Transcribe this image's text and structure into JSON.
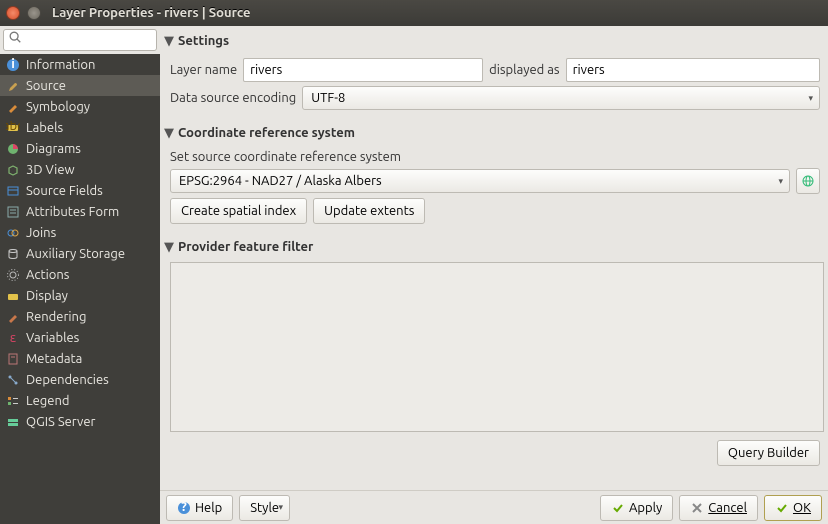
{
  "window": {
    "title": "Layer Properties - rivers | Source"
  },
  "sidebar": {
    "search_placeholder": "",
    "items": [
      {
        "label": "Information"
      },
      {
        "label": "Source"
      },
      {
        "label": "Symbology"
      },
      {
        "label": "Labels"
      },
      {
        "label": "Diagrams"
      },
      {
        "label": "3D View"
      },
      {
        "label": "Source Fields"
      },
      {
        "label": "Attributes Form"
      },
      {
        "label": "Joins"
      },
      {
        "label": "Auxiliary Storage"
      },
      {
        "label": "Actions"
      },
      {
        "label": "Display"
      },
      {
        "label": "Rendering"
      },
      {
        "label": "Variables"
      },
      {
        "label": "Metadata"
      },
      {
        "label": "Dependencies"
      },
      {
        "label": "Legend"
      },
      {
        "label": "QGIS Server"
      }
    ],
    "selected_index": 1
  },
  "sections": {
    "settings": {
      "title": "Settings",
      "layer_name_label": "Layer name",
      "layer_name_value": "rivers",
      "displayed_as_label": "displayed as",
      "displayed_as_value": "rivers",
      "encoding_label": "Data source encoding",
      "encoding_value": "UTF-8"
    },
    "crs": {
      "title": "Coordinate reference system",
      "set_label": "Set source coordinate reference system",
      "crs_value": "EPSG:2964 - NAD27 / Alaska Albers",
      "create_spatial_index": "Create spatial index",
      "update_extents": "Update extents"
    },
    "filter": {
      "title": "Provider feature filter",
      "query_builder": "Query Builder"
    }
  },
  "buttons": {
    "help": "Help",
    "style": "Style",
    "apply": "Apply",
    "cancel": "Cancel",
    "ok": "OK"
  }
}
